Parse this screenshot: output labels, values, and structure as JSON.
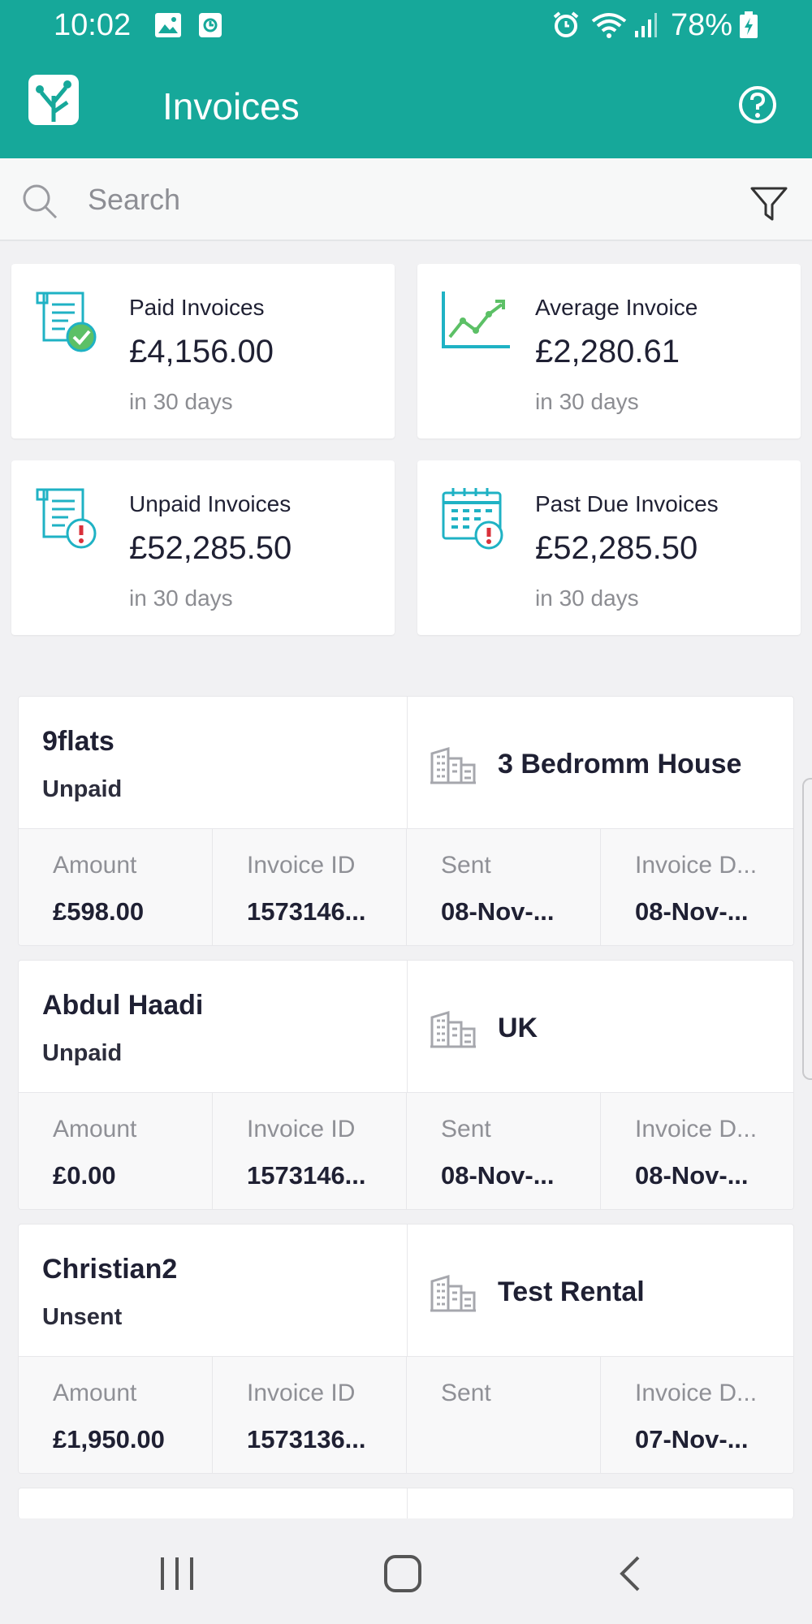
{
  "statusbar": {
    "time": "10:02",
    "battery_percent": "78%",
    "icons": [
      "image-icon",
      "screen-record-icon",
      "alarm-icon",
      "wifi-icon",
      "signal-icon",
      "battery-charging-icon"
    ]
  },
  "appbar": {
    "title": "Invoices",
    "logo_icon": "tree-logo-icon",
    "help_icon": "help-circle-icon"
  },
  "search": {
    "placeholder": "Search",
    "value": "",
    "filter_icon": "filter-icon"
  },
  "summary": [
    {
      "label": "Paid Invoices",
      "value": "£4,156.00",
      "period": "in 30 days",
      "icon": "paid-invoice-icon"
    },
    {
      "label": "Average Invoice",
      "value": "£2,280.61",
      "period": "in 30 days",
      "icon": "trend-chart-icon"
    },
    {
      "label": "Unpaid Invoices",
      "value": "£52,285.50",
      "period": "in 30 days",
      "icon": "unpaid-invoice-icon"
    },
    {
      "label": "Past Due Invoices",
      "value": "£52,285.50",
      "period": "in 30 days",
      "icon": "past-due-calendar-icon"
    }
  ],
  "invoices": [
    {
      "client": "9flats",
      "status": "Unpaid",
      "property": "3 Bedromm House",
      "fields": [
        {
          "label": "Amount",
          "value": "£598.00"
        },
        {
          "label": "Invoice ID",
          "value": "1573146..."
        },
        {
          "label": "Sent",
          "value": "08-Nov-..."
        },
        {
          "label": "Invoice D...",
          "value": "08-Nov-..."
        }
      ]
    },
    {
      "client": "Abdul Haadi",
      "status": "Unpaid",
      "property": "UK",
      "fields": [
        {
          "label": "Amount",
          "value": "£0.00"
        },
        {
          "label": "Invoice ID",
          "value": "1573146..."
        },
        {
          "label": "Sent",
          "value": "08-Nov-..."
        },
        {
          "label": "Invoice D...",
          "value": "08-Nov-..."
        }
      ]
    },
    {
      "client": "Christian2",
      "status": "Unsent",
      "property": "Test Rental",
      "fields": [
        {
          "label": "Amount",
          "value": "£1,950.00"
        },
        {
          "label": "Invoice ID",
          "value": "1573136..."
        },
        {
          "label": "Sent",
          "value": ""
        },
        {
          "label": "Invoice D...",
          "value": "07-Nov-..."
        }
      ]
    }
  ],
  "navbar": {
    "icons": [
      "recent-apps-icon",
      "home-icon",
      "back-icon"
    ]
  },
  "colors": {
    "brand": "#16a89a",
    "accent_icon": "#1fb2c4",
    "alert": "#d9303a",
    "success": "#5cc066"
  }
}
